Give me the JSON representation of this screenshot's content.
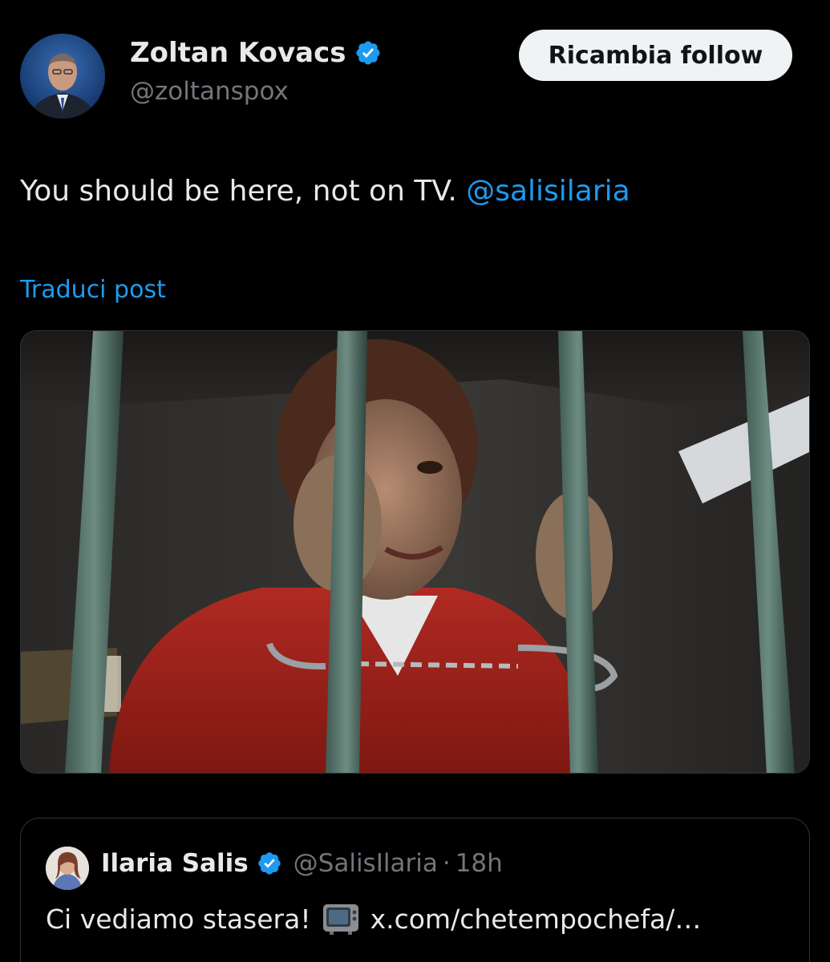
{
  "author": {
    "display_name": "Zoltan Kovacs",
    "handle": "@zoltanspox",
    "avatar_icon": "profile-photo-icon",
    "verified_icon": "verified-badge-icon"
  },
  "actions": {
    "follow_label": "Ricambia follow"
  },
  "post": {
    "text": "You should be here, not on TV.",
    "mention": "@salisilaria",
    "translate_label": "Traduci post"
  },
  "media": {
    "icon": "prison-image-icon"
  },
  "quote": {
    "display_name": "Ilaria Salis",
    "handle": "@SalisIlaria",
    "separator": "·",
    "time": "18h",
    "text": "Ci vediamo stasera!",
    "link": "x.com/chetempochefa/…",
    "tv_icon": "television-icon"
  },
  "colors": {
    "background": "#000000",
    "text": "#e7e9ea",
    "muted": "#71767b",
    "accent": "#1d9bf0",
    "button_bg": "#eff3f4"
  }
}
